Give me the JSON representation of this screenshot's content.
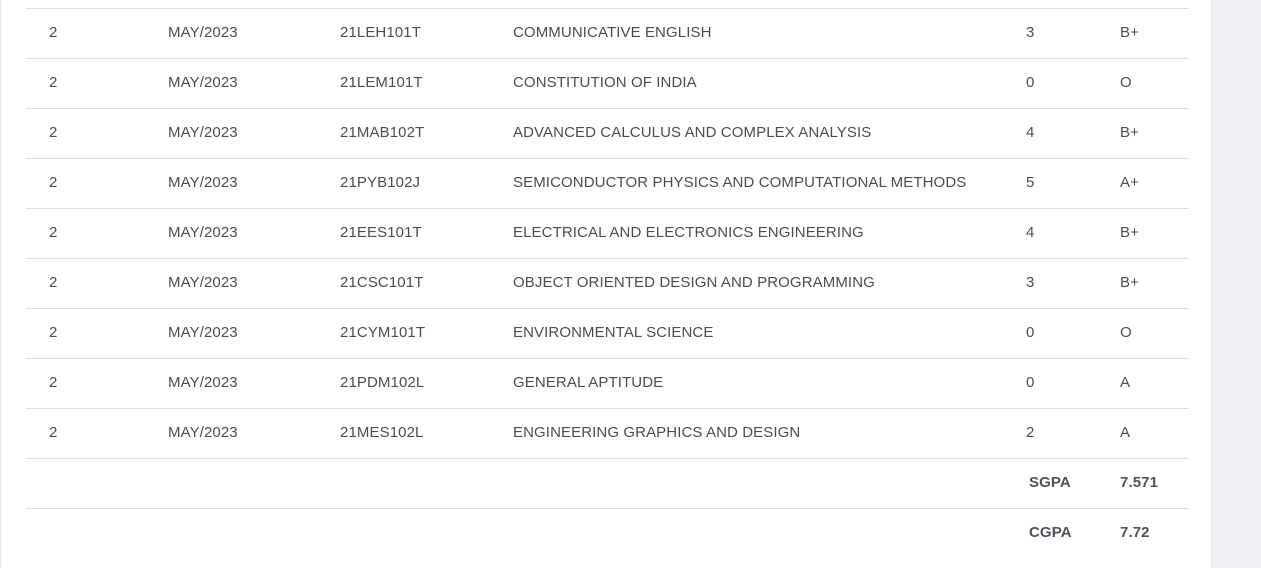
{
  "results": {
    "rows": [
      {
        "semester": "2",
        "month_year": "MAY/2023",
        "code": "21LEH101T",
        "title": "COMMUNICATIVE ENGLISH",
        "credit": "3",
        "grade": "B+"
      },
      {
        "semester": "2",
        "month_year": "MAY/2023",
        "code": "21LEM101T",
        "title": "CONSTITUTION OF INDIA",
        "credit": "0",
        "grade": "O"
      },
      {
        "semester": "2",
        "month_year": "MAY/2023",
        "code": "21MAB102T",
        "title": "ADVANCED CALCULUS AND COMPLEX ANALYSIS",
        "credit": "4",
        "grade": "B+"
      },
      {
        "semester": "2",
        "month_year": "MAY/2023",
        "code": "21PYB102J",
        "title": "SEMICONDUCTOR PHYSICS AND COMPUTATIONAL METHODS",
        "credit": "5",
        "grade": "A+"
      },
      {
        "semester": "2",
        "month_year": "MAY/2023",
        "code": "21EES101T",
        "title": "ELECTRICAL AND ELECTRONICS ENGINEERING",
        "credit": "4",
        "grade": "B+"
      },
      {
        "semester": "2",
        "month_year": "MAY/2023",
        "code": "21CSC101T",
        "title": "OBJECT ORIENTED DESIGN AND PROGRAMMING",
        "credit": "3",
        "grade": "B+"
      },
      {
        "semester": "2",
        "month_year": "MAY/2023",
        "code": "21CYM101T",
        "title": "ENVIRONMENTAL SCIENCE",
        "credit": "0",
        "grade": "O"
      },
      {
        "semester": "2",
        "month_year": "MAY/2023",
        "code": "21PDM102L",
        "title": "GENERAL APTITUDE",
        "credit": "0",
        "grade": "A"
      },
      {
        "semester": "2",
        "month_year": "MAY/2023",
        "code": "21MES102L",
        "title": "ENGINEERING GRAPHICS AND DESIGN",
        "credit": "2",
        "grade": "A"
      }
    ],
    "summary": [
      {
        "label": "SGPA",
        "value": "7.571"
      },
      {
        "label": "CGPA",
        "value": "7.72"
      }
    ]
  }
}
